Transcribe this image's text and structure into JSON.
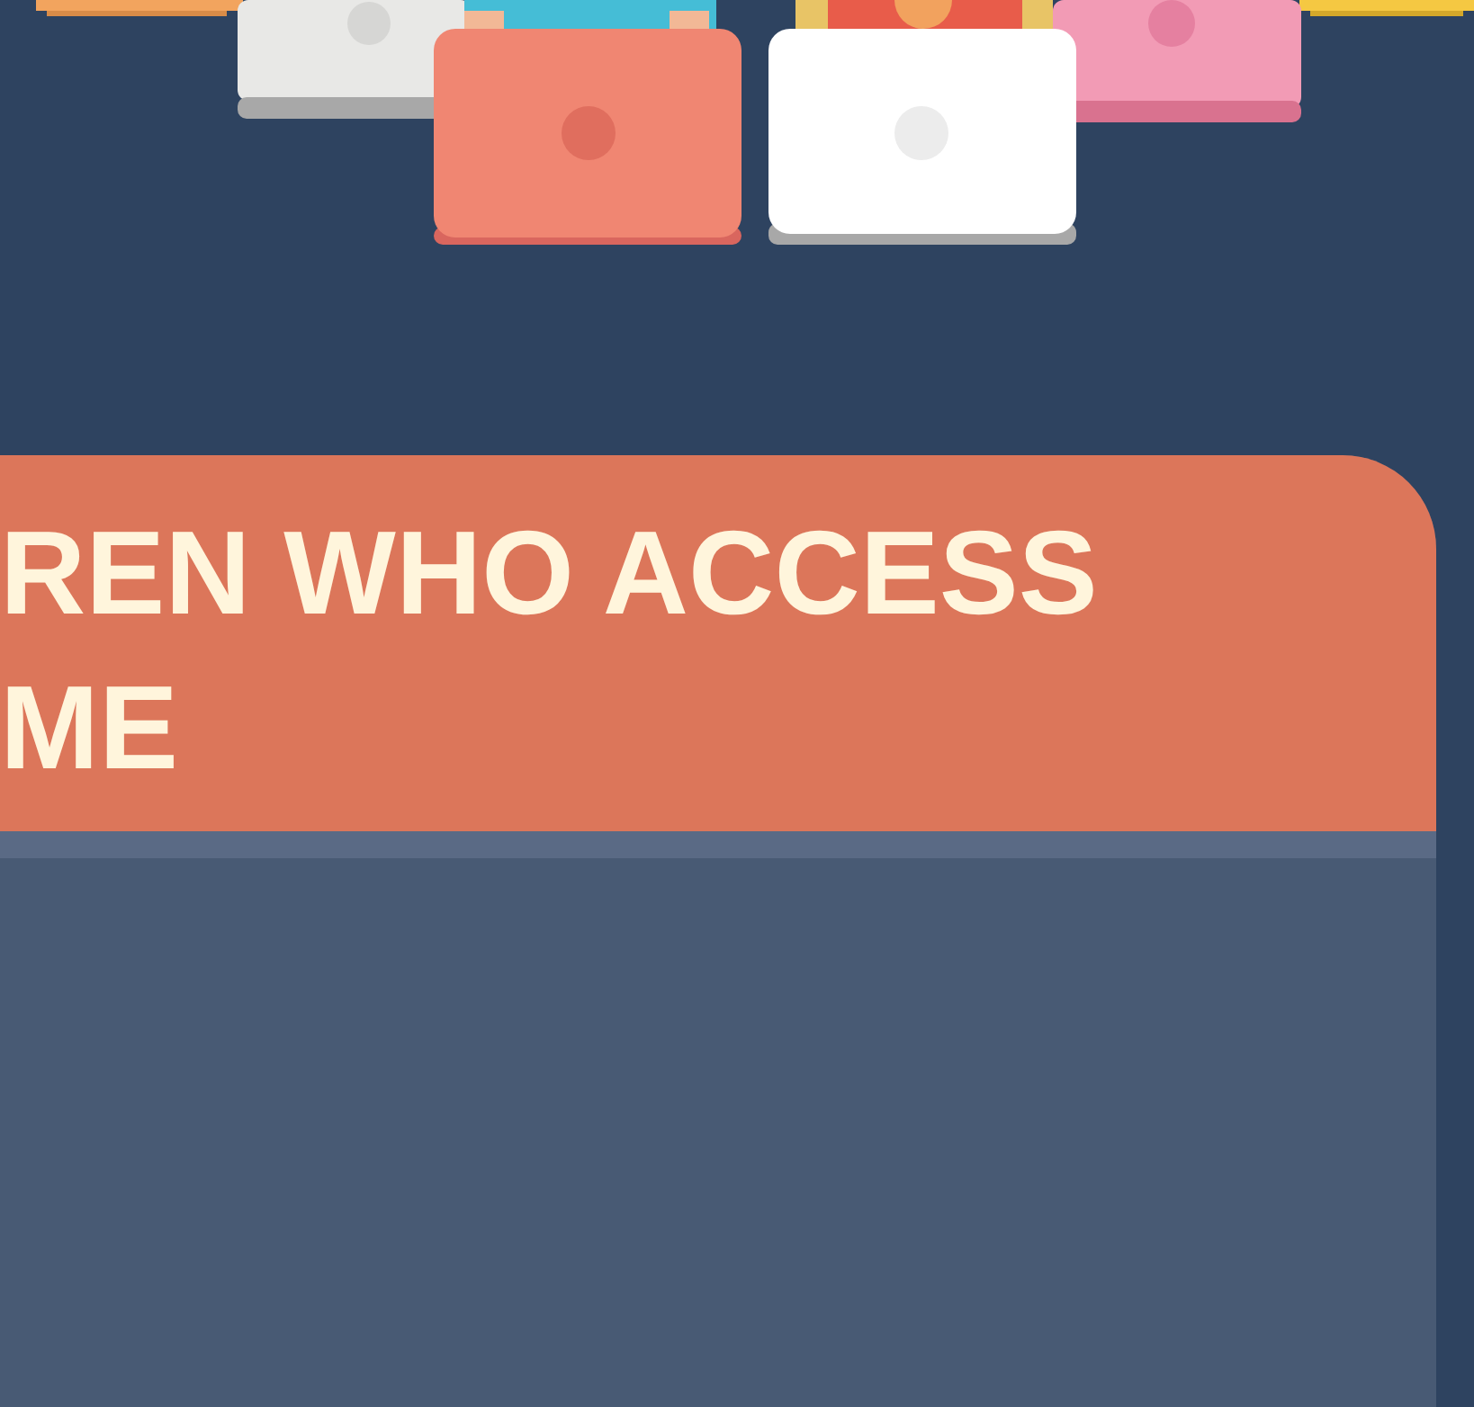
{
  "card": {
    "title_lines": [
      "REN WHO ACCESS",
      "ME"
    ]
  }
}
